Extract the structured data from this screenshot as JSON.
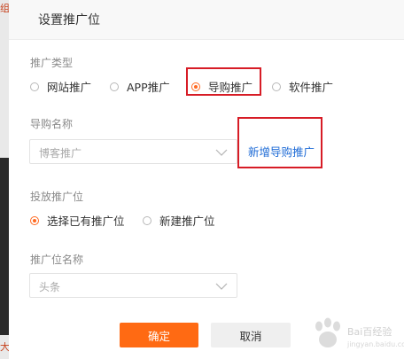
{
  "background": {
    "edge_fragment_top": "组",
    "edge_fragment_bottom": "大"
  },
  "dialog": {
    "title": "设置推广位"
  },
  "promotion_type": {
    "label": "推广类型",
    "options": [
      {
        "label": "网站推广",
        "checked": false
      },
      {
        "label": "APP推广",
        "checked": false
      },
      {
        "label": "导购推广",
        "checked": true
      },
      {
        "label": "软件推广",
        "checked": false
      }
    ]
  },
  "guide_name": {
    "label": "导购名称",
    "selected": "博客推广",
    "add_link": "新增导购推广"
  },
  "placement": {
    "label": "投放推广位",
    "options": [
      {
        "label": "选择已有推广位",
        "checked": true
      },
      {
        "label": "新建推广位",
        "checked": false
      }
    ]
  },
  "slot_name": {
    "label": "推广位名称",
    "selected": "头条"
  },
  "buttons": {
    "confirm": "确定",
    "cancel": "取消"
  },
  "watermark": {
    "text": "Bai百经验",
    "sub": "jingyan.baidu.com"
  },
  "colors": {
    "accent": "#ff6a13",
    "highlight_border": "#d71c26",
    "link": "#1e6bd6"
  }
}
